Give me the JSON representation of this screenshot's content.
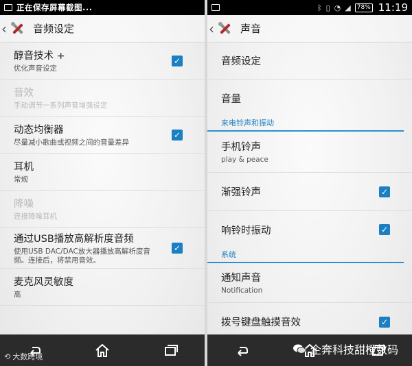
{
  "left": {
    "status_text": "正在保存屏幕截图...",
    "title": "音频设定",
    "items": [
      {
        "title": "醇音技术 +",
        "sub": "优化声音设定",
        "checked": true,
        "disabled": false
      },
      {
        "title": "音效",
        "sub": "手动调节一系列声音增强设定",
        "checked": null,
        "disabled": true
      },
      {
        "title": "动态均衡器",
        "sub": "尽量减小歌曲或视频之间的音量差异",
        "checked": true,
        "disabled": false
      },
      {
        "title": "耳机",
        "sub": "常规",
        "checked": null,
        "disabled": false
      },
      {
        "title": "降噪",
        "sub": "连接降噪耳机",
        "checked": null,
        "disabled": true
      },
      {
        "title": "通过USB播放高解析度音频",
        "sub": "使用USB DAC/DAC放大器播放高解析度音频。连接后，将禁用音效。",
        "checked": true,
        "disabled": false
      },
      {
        "title": "麦克风灵敏度",
        "sub": "高",
        "checked": null,
        "disabled": false
      }
    ],
    "watermark": "大数跨境"
  },
  "right": {
    "battery": "78%",
    "clock": "11:19",
    "title": "声音",
    "row1": {
      "title": "音频设定"
    },
    "row2": {
      "title": "音量"
    },
    "section1": "来电铃声和振动",
    "row3": {
      "title": "手机铃声",
      "sub": "play & peace"
    },
    "row4": {
      "title": "渐强铃声",
      "checked": true
    },
    "row5": {
      "title": "响铃时振动",
      "checked": true
    },
    "section2": "系统",
    "row6": {
      "title": "通知声音",
      "sub": "Notification"
    },
    "row7": {
      "title": "拨号键盘触摸音效",
      "checked": true
    },
    "watermark": "企奔科技甜橙数码"
  },
  "icons": {
    "back": "back-icon",
    "home": "home-icon",
    "recents": "recent-apps-icon",
    "settings": "settings-tools-icon"
  },
  "colors": {
    "accent": "#1b7fc1",
    "navbar": "#2b2b2b"
  }
}
